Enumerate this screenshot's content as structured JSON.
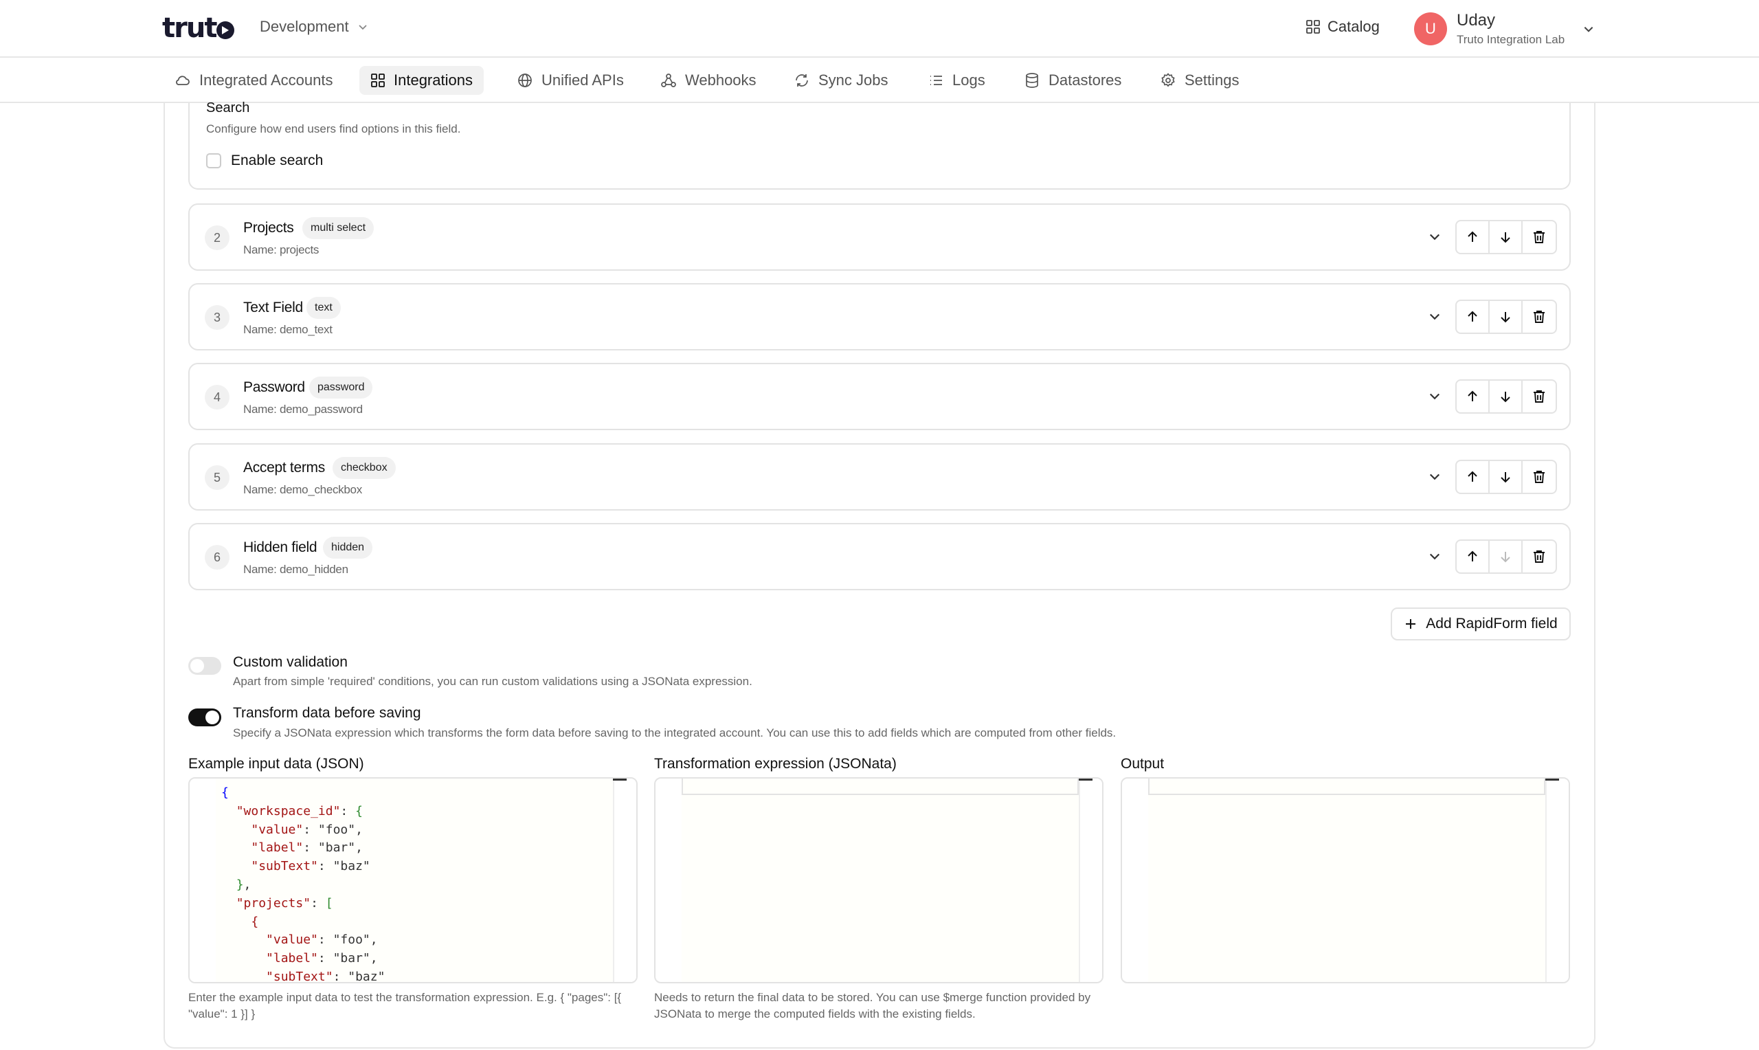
{
  "header": {
    "logo_text": "truto",
    "environment": "Development",
    "catalog_label": "Catalog",
    "user": {
      "initial": "U",
      "name": "Uday",
      "org": "Truto Integration Lab"
    }
  },
  "nav": {
    "items": [
      {
        "label": "Integrated Accounts",
        "icon": "cloud-icon"
      },
      {
        "label": "Integrations",
        "icon": "grid-icon",
        "active": true
      },
      {
        "label": "Unified APIs",
        "icon": "globe-icon"
      },
      {
        "label": "Webhooks",
        "icon": "webhook-icon"
      },
      {
        "label": "Sync Jobs",
        "icon": "sync-icon"
      },
      {
        "label": "Logs",
        "icon": "list-icon"
      },
      {
        "label": "Datastores",
        "icon": "database-icon"
      },
      {
        "label": "Settings",
        "icon": "gear-icon"
      }
    ]
  },
  "search_section": {
    "title": "Search",
    "description": "Configure how end users find options in this field.",
    "enable_label": "Enable search",
    "enabled": false
  },
  "fields": [
    {
      "number": "2",
      "label": "Projects",
      "type": "multi select",
      "name": "Name: projects"
    },
    {
      "number": "3",
      "label": "Text Field",
      "type": "text",
      "name": "Name: demo_text"
    },
    {
      "number": "4",
      "label": "Password",
      "type": "password",
      "name": "Name: demo_password"
    },
    {
      "number": "5",
      "label": "Accept terms",
      "type": "checkbox",
      "name": "Name: demo_checkbox"
    },
    {
      "number": "6",
      "label": "Hidden field",
      "type": "hidden",
      "name": "Name: demo_hidden"
    }
  ],
  "add_field_label": "Add RapidForm field",
  "custom_validation": {
    "title": "Custom validation",
    "description": "Apart from simple 'required' conditions, you can run custom validations using a JSONata expression.",
    "enabled": false
  },
  "transform": {
    "title": "Transform data before saving",
    "description": "Specify a JSONata expression which transforms the form data before saving to the integrated account. You can use this to add fields which are computed from other fields.",
    "enabled": true
  },
  "editors": {
    "input": {
      "label": "Example input data (JSON)",
      "help": "Enter the example input data to test the transformation expression. E.g. { \"pages\": [{ \"value\": 1 }] }",
      "lines": [
        "{",
        "  \"workspace_id\": {",
        "    \"value\": \"foo\",",
        "    \"label\": \"bar\",",
        "    \"subText\": \"baz\"",
        "  },",
        "  \"projects\": [",
        "    {",
        "      \"value\": \"foo\",",
        "      \"label\": \"bar\",",
        "      \"subText\": \"baz\""
      ]
    },
    "expression": {
      "label": "Transformation expression (JSONata)",
      "help": "Needs to return the final data to be stored. You can use $merge function provided by JSONata to merge the computed fields with the existing fields."
    },
    "output": {
      "label": "Output"
    }
  }
}
